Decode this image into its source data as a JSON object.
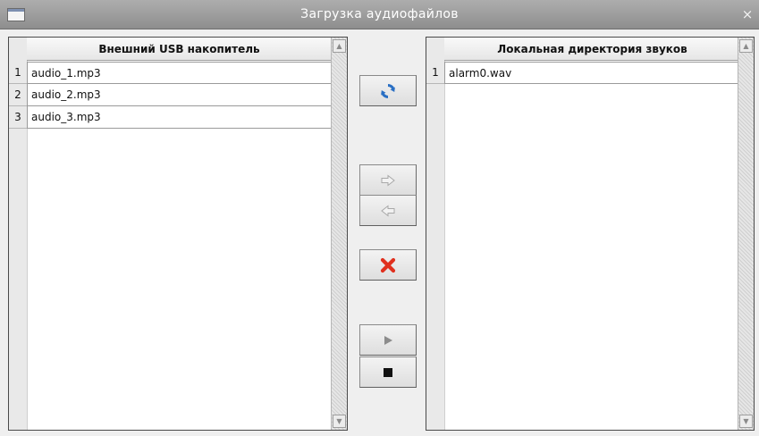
{
  "window": {
    "title": "Загрузка аудиофайлов",
    "close_glyph": "×"
  },
  "left_panel": {
    "header": "Внешний USB накопитель",
    "rows": [
      {
        "num": "1",
        "name": "audio_1.mp3"
      },
      {
        "num": "2",
        "name": "audio_2.mp3"
      },
      {
        "num": "3",
        "name": "audio_3.mp3"
      }
    ]
  },
  "right_panel": {
    "header": "Локальная директория звуков",
    "rows": [
      {
        "num": "1",
        "name": "alarm0.wav"
      }
    ]
  },
  "toolbar": {
    "refresh_icon": "refresh-icon",
    "copy_to_local_icon": "arrow-right-icon",
    "copy_to_usb_icon": "arrow-left-icon",
    "delete_icon": "delete-x-icon",
    "play_icon": "play-icon",
    "stop_icon": "stop-icon"
  },
  "colors": {
    "titlebar": "#9a9a9a",
    "refresh_blue": "#2a6fc4",
    "delete_red": "#e0301e"
  }
}
